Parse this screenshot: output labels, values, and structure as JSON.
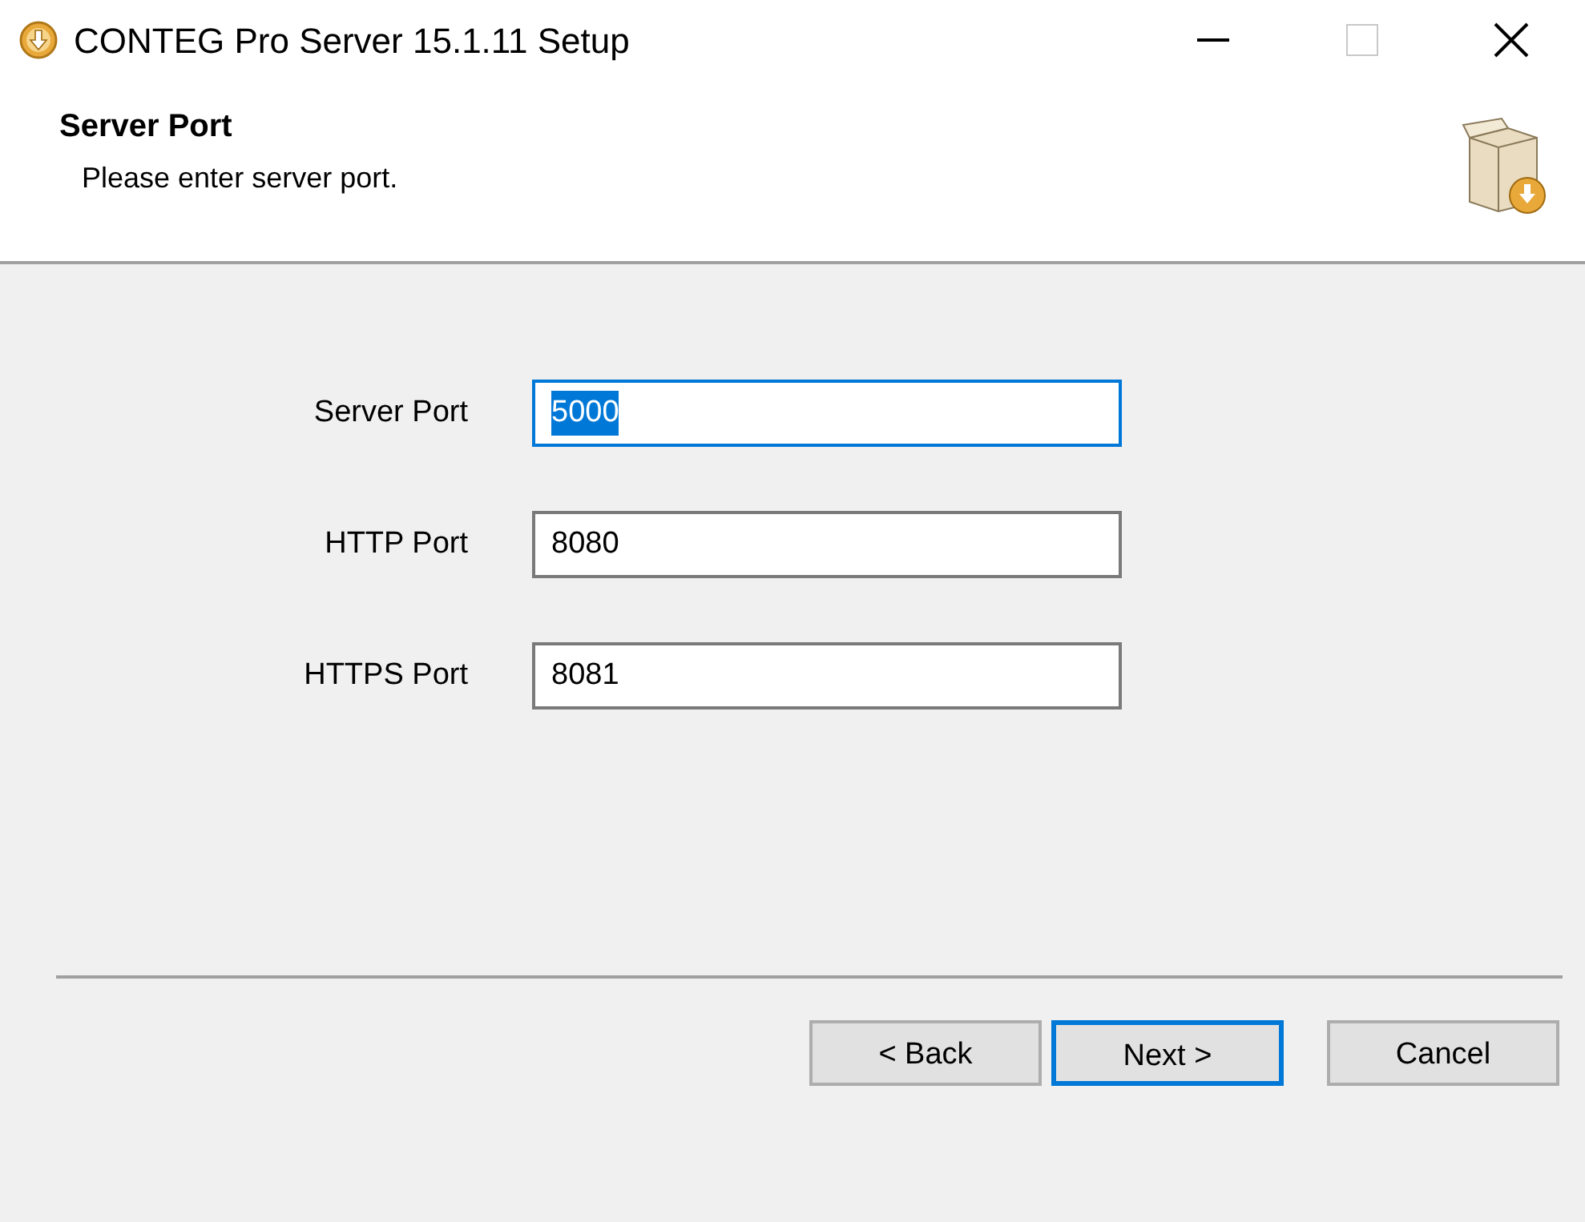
{
  "window": {
    "title": "CONTEG Pro Server 15.1.11 Setup"
  },
  "header": {
    "title": "Server Port",
    "subtitle": "Please enter server port."
  },
  "fields": [
    {
      "label": "Server Port",
      "value": "5000",
      "focused": true
    },
    {
      "label": "HTTP Port",
      "value": "8080",
      "focused": false
    },
    {
      "label": "HTTPS Port",
      "value": "8081",
      "focused": false
    }
  ],
  "buttons": [
    {
      "label": "< Back",
      "default": false
    },
    {
      "label": "Next >",
      "default": true
    },
    {
      "label": "Cancel",
      "default": false
    }
  ]
}
